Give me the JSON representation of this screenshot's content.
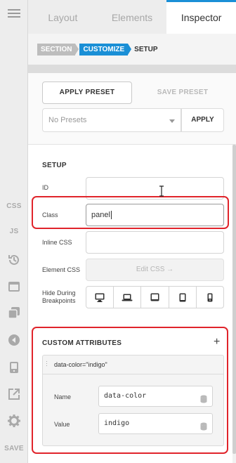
{
  "rail": {
    "css_label": "CSS",
    "js_label": "JS",
    "save_label": "SAVE"
  },
  "tabs": [
    {
      "label": "Layout"
    },
    {
      "label": "Elements"
    },
    {
      "label": "Inspector"
    }
  ],
  "breadcrumb": [
    "SECTION",
    "CUSTOMIZE",
    "SETUP"
  ],
  "presets": {
    "apply_preset_label": "APPLY PRESET",
    "save_preset_label": "SAVE PRESET",
    "select_value": "No Presets",
    "apply_label": "APPLY"
  },
  "setup": {
    "title": "SETUP",
    "id_label": "ID",
    "id_value": "",
    "class_label": "Class",
    "class_value": "panel",
    "inline_css_label": "Inline CSS",
    "inline_css_value": "",
    "element_css_label": "Element CSS",
    "edit_css_label": "Edit CSS →",
    "hide_label_line1": "Hide During",
    "hide_label_line2": "Breakpoints",
    "breakpoints": [
      "desktop-icon",
      "laptop-icon",
      "tablet-landscape-icon",
      "tablet-portrait-icon",
      "phone-icon"
    ]
  },
  "custom_attributes": {
    "title": "CUSTOM ATTRIBUTES",
    "add_label": "+",
    "item_header": "data-color=\"indigo\"",
    "name_label": "Name",
    "name_value": "data-color",
    "value_label": "Value",
    "value_value": "indigo"
  },
  "colors": {
    "accent": "#1a8fd6",
    "highlight": "#e0242b",
    "rail_bg": "#ededed"
  }
}
